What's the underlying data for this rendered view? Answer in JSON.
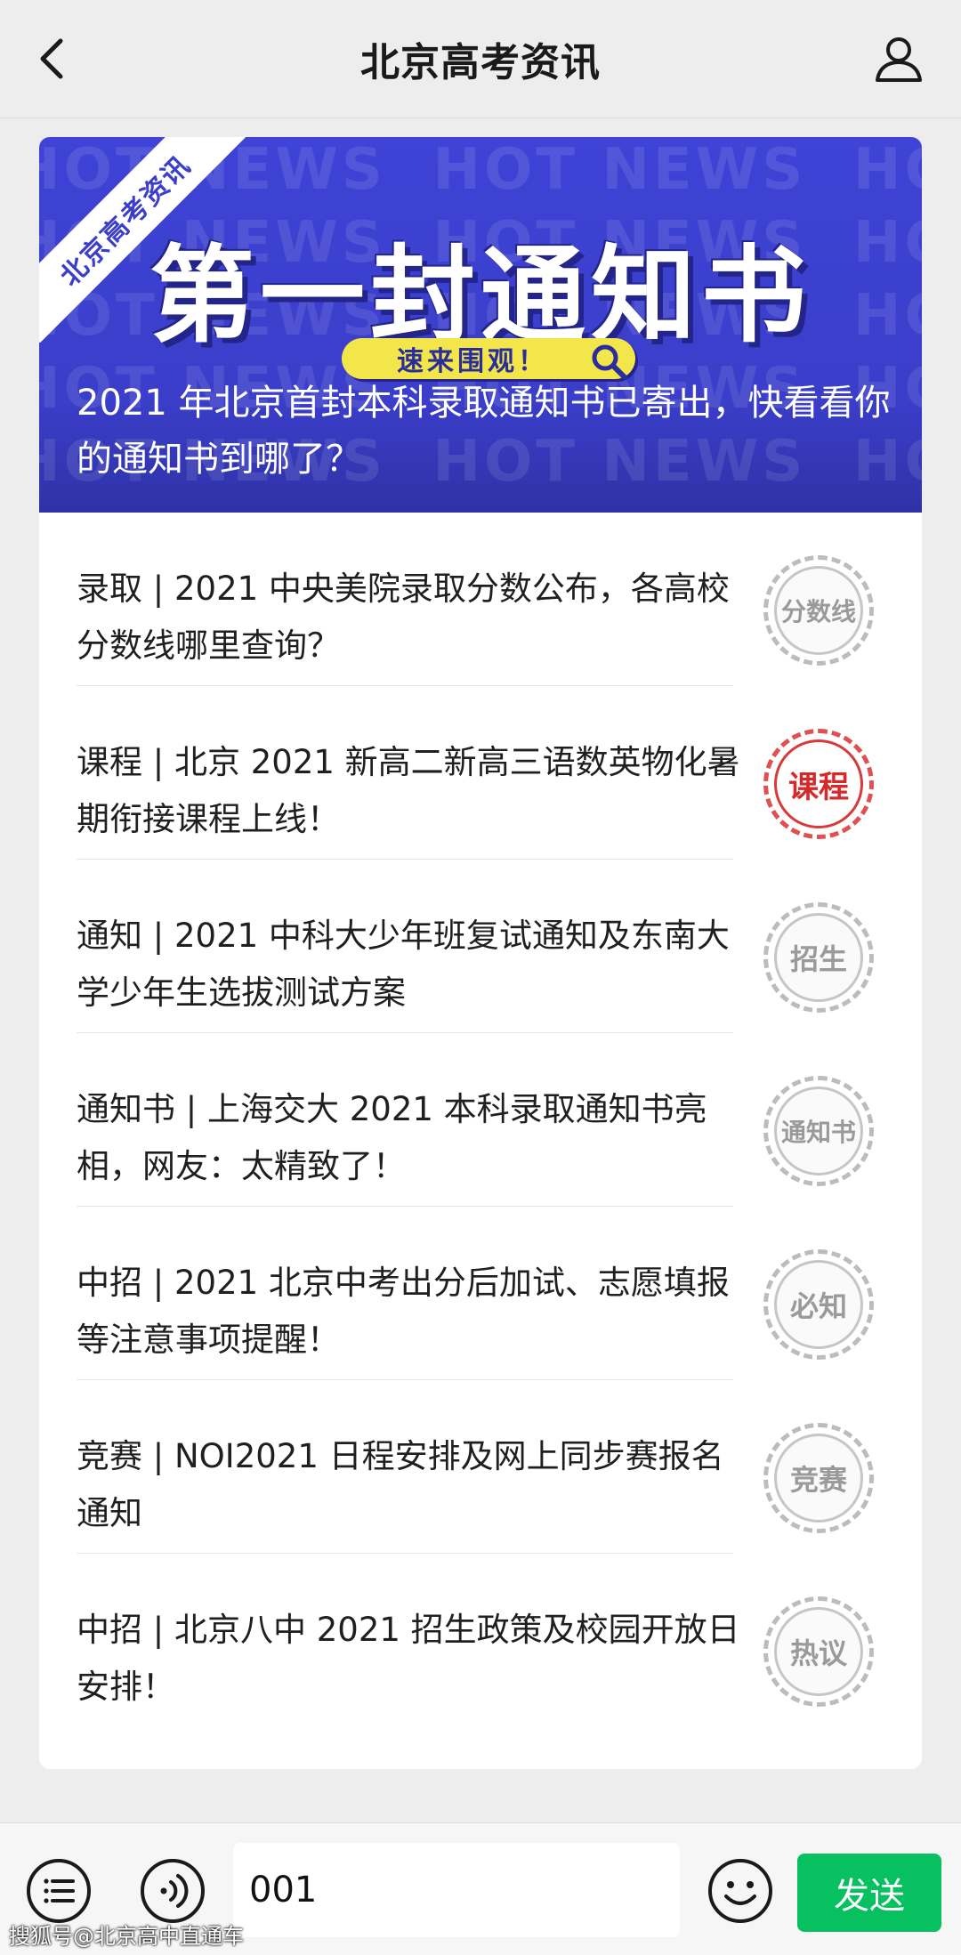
{
  "header": {
    "title": "北京高考资讯"
  },
  "banner": {
    "watermark_text": "HOT NEWS",
    "ribbon": "北京高考资讯",
    "headline": "第一封通知书",
    "pill": "速来围观！",
    "caption": "2021 年北京首封本科录取通知书已寄出，快看看你的通知书到哪了？"
  },
  "items": [
    {
      "text": "录取 | 2021 中央美院录取分数公布，各高校分数线哪里查询？",
      "badge": "分数线",
      "badge_style": "grey-small"
    },
    {
      "text": "课程 | 北京 2021 新高二新高三语数英物化暑期衔接课程上线！",
      "badge": "课程",
      "badge_style": "red"
    },
    {
      "text": "通知 |  2021 中科大少年班复试通知及东南大学少年生选拔测试方案",
      "badge": "招生",
      "badge_style": "grey"
    },
    {
      "text": "通知书 | 上海交大 2021 本科录取通知书亮相，网友：太精致了！",
      "badge": "通知书",
      "badge_style": "grey-small"
    },
    {
      "text": "中招 | 2021 北京中考出分后加试、志愿填报等注意事项提醒！",
      "badge": "必知",
      "badge_style": "grey"
    },
    {
      "text": "竞赛 | NOI2021 日程安排及网上同步赛报名通知",
      "badge": "竞赛",
      "badge_style": "grey"
    },
    {
      "text": "中招 | 北京八中 2021 招生政策及校园开放日安排！",
      "badge": "热议",
      "badge_style": "grey"
    }
  ],
  "bottombar": {
    "input_value": "001",
    "send_label": "发送",
    "watermark": "搜狐号@北京高中直通车"
  },
  "colors": {
    "send_green": "#07c160",
    "banner_blue": "#3a3ec9",
    "badge_red": "#d42a2a"
  }
}
